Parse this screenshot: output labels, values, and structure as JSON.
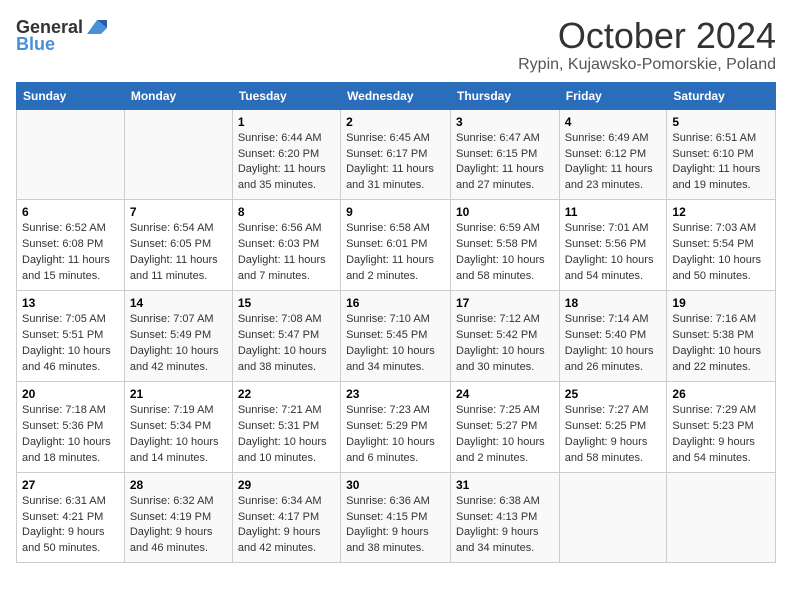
{
  "header": {
    "logo_general": "General",
    "logo_blue": "Blue",
    "month": "October 2024",
    "location": "Rypin, Kujawsko-Pomorskie, Poland"
  },
  "weekdays": [
    "Sunday",
    "Monday",
    "Tuesday",
    "Wednesday",
    "Thursday",
    "Friday",
    "Saturday"
  ],
  "weeks": [
    [
      {
        "day": "",
        "sunrise": "",
        "sunset": "",
        "daylight": ""
      },
      {
        "day": "",
        "sunrise": "",
        "sunset": "",
        "daylight": ""
      },
      {
        "day": "1",
        "sunrise": "Sunrise: 6:44 AM",
        "sunset": "Sunset: 6:20 PM",
        "daylight": "Daylight: 11 hours and 35 minutes."
      },
      {
        "day": "2",
        "sunrise": "Sunrise: 6:45 AM",
        "sunset": "Sunset: 6:17 PM",
        "daylight": "Daylight: 11 hours and 31 minutes."
      },
      {
        "day": "3",
        "sunrise": "Sunrise: 6:47 AM",
        "sunset": "Sunset: 6:15 PM",
        "daylight": "Daylight: 11 hours and 27 minutes."
      },
      {
        "day": "4",
        "sunrise": "Sunrise: 6:49 AM",
        "sunset": "Sunset: 6:12 PM",
        "daylight": "Daylight: 11 hours and 23 minutes."
      },
      {
        "day": "5",
        "sunrise": "Sunrise: 6:51 AM",
        "sunset": "Sunset: 6:10 PM",
        "daylight": "Daylight: 11 hours and 19 minutes."
      }
    ],
    [
      {
        "day": "6",
        "sunrise": "Sunrise: 6:52 AM",
        "sunset": "Sunset: 6:08 PM",
        "daylight": "Daylight: 11 hours and 15 minutes."
      },
      {
        "day": "7",
        "sunrise": "Sunrise: 6:54 AM",
        "sunset": "Sunset: 6:05 PM",
        "daylight": "Daylight: 11 hours and 11 minutes."
      },
      {
        "day": "8",
        "sunrise": "Sunrise: 6:56 AM",
        "sunset": "Sunset: 6:03 PM",
        "daylight": "Daylight: 11 hours and 7 minutes."
      },
      {
        "day": "9",
        "sunrise": "Sunrise: 6:58 AM",
        "sunset": "Sunset: 6:01 PM",
        "daylight": "Daylight: 11 hours and 2 minutes."
      },
      {
        "day": "10",
        "sunrise": "Sunrise: 6:59 AM",
        "sunset": "Sunset: 5:58 PM",
        "daylight": "Daylight: 10 hours and 58 minutes."
      },
      {
        "day": "11",
        "sunrise": "Sunrise: 7:01 AM",
        "sunset": "Sunset: 5:56 PM",
        "daylight": "Daylight: 10 hours and 54 minutes."
      },
      {
        "day": "12",
        "sunrise": "Sunrise: 7:03 AM",
        "sunset": "Sunset: 5:54 PM",
        "daylight": "Daylight: 10 hours and 50 minutes."
      }
    ],
    [
      {
        "day": "13",
        "sunrise": "Sunrise: 7:05 AM",
        "sunset": "Sunset: 5:51 PM",
        "daylight": "Daylight: 10 hours and 46 minutes."
      },
      {
        "day": "14",
        "sunrise": "Sunrise: 7:07 AM",
        "sunset": "Sunset: 5:49 PM",
        "daylight": "Daylight: 10 hours and 42 minutes."
      },
      {
        "day": "15",
        "sunrise": "Sunrise: 7:08 AM",
        "sunset": "Sunset: 5:47 PM",
        "daylight": "Daylight: 10 hours and 38 minutes."
      },
      {
        "day": "16",
        "sunrise": "Sunrise: 7:10 AM",
        "sunset": "Sunset: 5:45 PM",
        "daylight": "Daylight: 10 hours and 34 minutes."
      },
      {
        "day": "17",
        "sunrise": "Sunrise: 7:12 AM",
        "sunset": "Sunset: 5:42 PM",
        "daylight": "Daylight: 10 hours and 30 minutes."
      },
      {
        "day": "18",
        "sunrise": "Sunrise: 7:14 AM",
        "sunset": "Sunset: 5:40 PM",
        "daylight": "Daylight: 10 hours and 26 minutes."
      },
      {
        "day": "19",
        "sunrise": "Sunrise: 7:16 AM",
        "sunset": "Sunset: 5:38 PM",
        "daylight": "Daylight: 10 hours and 22 minutes."
      }
    ],
    [
      {
        "day": "20",
        "sunrise": "Sunrise: 7:18 AM",
        "sunset": "Sunset: 5:36 PM",
        "daylight": "Daylight: 10 hours and 18 minutes."
      },
      {
        "day": "21",
        "sunrise": "Sunrise: 7:19 AM",
        "sunset": "Sunset: 5:34 PM",
        "daylight": "Daylight: 10 hours and 14 minutes."
      },
      {
        "day": "22",
        "sunrise": "Sunrise: 7:21 AM",
        "sunset": "Sunset: 5:31 PM",
        "daylight": "Daylight: 10 hours and 10 minutes."
      },
      {
        "day": "23",
        "sunrise": "Sunrise: 7:23 AM",
        "sunset": "Sunset: 5:29 PM",
        "daylight": "Daylight: 10 hours and 6 minutes."
      },
      {
        "day": "24",
        "sunrise": "Sunrise: 7:25 AM",
        "sunset": "Sunset: 5:27 PM",
        "daylight": "Daylight: 10 hours and 2 minutes."
      },
      {
        "day": "25",
        "sunrise": "Sunrise: 7:27 AM",
        "sunset": "Sunset: 5:25 PM",
        "daylight": "Daylight: 9 hours and 58 minutes."
      },
      {
        "day": "26",
        "sunrise": "Sunrise: 7:29 AM",
        "sunset": "Sunset: 5:23 PM",
        "daylight": "Daylight: 9 hours and 54 minutes."
      }
    ],
    [
      {
        "day": "27",
        "sunrise": "Sunrise: 6:31 AM",
        "sunset": "Sunset: 4:21 PM",
        "daylight": "Daylight: 9 hours and 50 minutes."
      },
      {
        "day": "28",
        "sunrise": "Sunrise: 6:32 AM",
        "sunset": "Sunset: 4:19 PM",
        "daylight": "Daylight: 9 hours and 46 minutes."
      },
      {
        "day": "29",
        "sunrise": "Sunrise: 6:34 AM",
        "sunset": "Sunset: 4:17 PM",
        "daylight": "Daylight: 9 hours and 42 minutes."
      },
      {
        "day": "30",
        "sunrise": "Sunrise: 6:36 AM",
        "sunset": "Sunset: 4:15 PM",
        "daylight": "Daylight: 9 hours and 38 minutes."
      },
      {
        "day": "31",
        "sunrise": "Sunrise: 6:38 AM",
        "sunset": "Sunset: 4:13 PM",
        "daylight": "Daylight: 9 hours and 34 minutes."
      },
      {
        "day": "",
        "sunrise": "",
        "sunset": "",
        "daylight": ""
      },
      {
        "day": "",
        "sunrise": "",
        "sunset": "",
        "daylight": ""
      }
    ]
  ]
}
